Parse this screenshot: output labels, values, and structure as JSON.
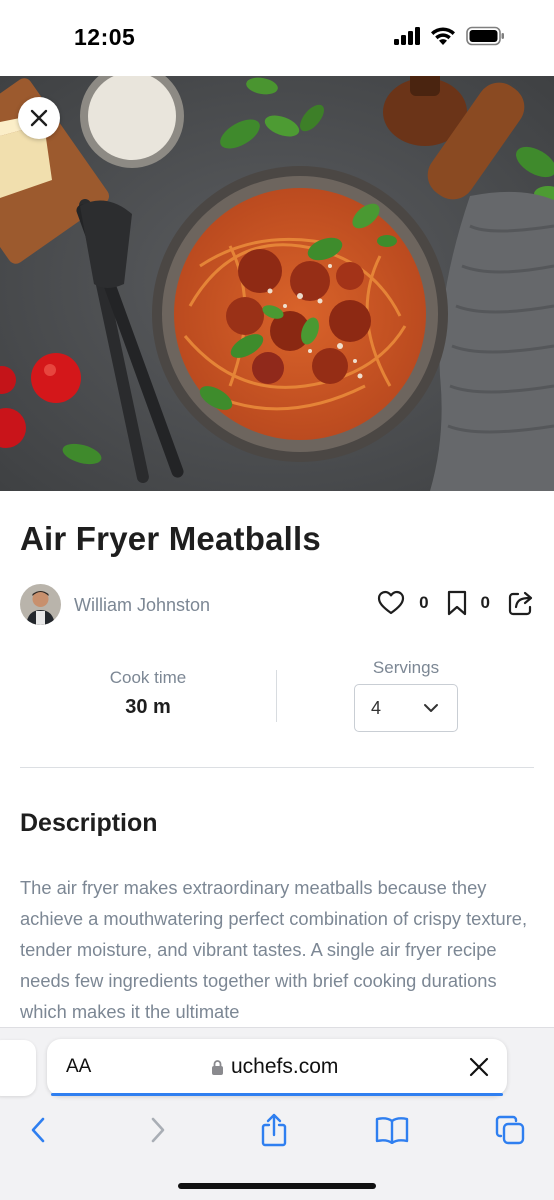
{
  "status": {
    "time": "12:05"
  },
  "recipe": {
    "title": "Air Fryer Meatballs",
    "author": "William Johnston",
    "likes": "0",
    "saves": "0",
    "cook_time_label": "Cook time",
    "cook_time_value": "30 m",
    "servings_label": "Servings",
    "servings_value": "4"
  },
  "description": {
    "heading": "Description",
    "text": "The air fryer makes extraordinary meatballs because they achieve a mouthwatering perfect combination of crispy texture, tender moisture, and vibrant tastes. A single air fryer recipe needs few ingredients together with brief cooking durations which makes it the ultimate"
  },
  "browser": {
    "text_size_label": "AA",
    "url": "uchefs.com"
  },
  "icons": {
    "close": "close-icon",
    "heart": "heart-icon",
    "bookmark": "bookmark-icon",
    "share": "share-icon",
    "chevron": "chevron-down-icon",
    "lock": "lock-icon",
    "back": "back-icon",
    "forward": "forward-icon",
    "share_sheet": "share-sheet-icon",
    "bookmarks": "bookmarks-icon",
    "tabs": "tabs-icon"
  },
  "colors": {
    "accent_blue": "#2f7ff0",
    "muted_text": "#7c8794",
    "heading_text": "#1e1e1e"
  }
}
